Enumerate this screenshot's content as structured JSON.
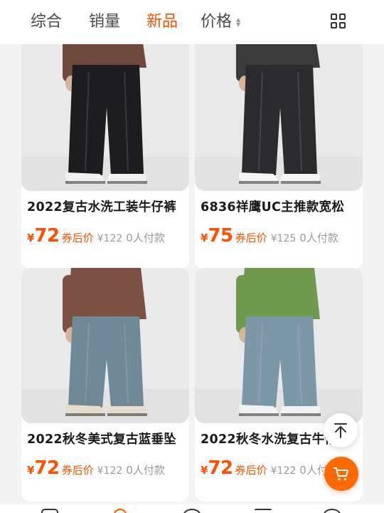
{
  "sort_bar": {
    "items": [
      {
        "label": "综合",
        "active": false
      },
      {
        "label": "销量",
        "active": false
      },
      {
        "label": "新品",
        "active": true
      },
      {
        "label": "价格",
        "active": false
      }
    ],
    "price_sort_arrows": {
      "up": "▲",
      "down": "▼"
    },
    "layout_toggle_icon": "grid-view-icon"
  },
  "colors": {
    "accent": "#ff5000",
    "cart_button": "#ff6a00",
    "muted": "#999999"
  },
  "products": [
    {
      "title": "2022复古水洗工装牛仔裤",
      "currency": "¥",
      "price": "72",
      "coupon_label": "券后价",
      "original_price": "¥122",
      "sold": "0人付款",
      "image": {
        "pants": "#1d1d1f",
        "top": "#6f4a3c",
        "shoes": "#f1f1f1"
      }
    },
    {
      "title": "6836祥鹰UC主推款宽松",
      "currency": "¥",
      "price": "75",
      "coupon_label": "券后价",
      "original_price": "¥125",
      "sold": "0人付款",
      "image": {
        "pants": "#2b2b2d",
        "top": "#3a3a3a",
        "shoes": "#f4f4f4"
      }
    },
    {
      "title": "2022秋冬美式复古蓝垂坠",
      "currency": "¥",
      "price": "72",
      "coupon_label": "券后价",
      "original_price": "¥122",
      "sold": "0人付款",
      "image": {
        "pants": "#6f8a96",
        "top": "#7a5142",
        "shoes": "#e6dccd"
      }
    },
    {
      "title": "2022秋冬水洗复古牛仔裤",
      "currency": "¥",
      "price": "72",
      "coupon_label": "券后价",
      "original_price": "¥122",
      "sold": "0人付款",
      "image": {
        "pants": "#7c97a5",
        "top": "#6f9a4d",
        "shoes": "#f2f2f2"
      }
    }
  ],
  "floating": {
    "back_to_top_icon": "arrow-up-to-line-icon",
    "cart_icon": "cart-icon"
  }
}
